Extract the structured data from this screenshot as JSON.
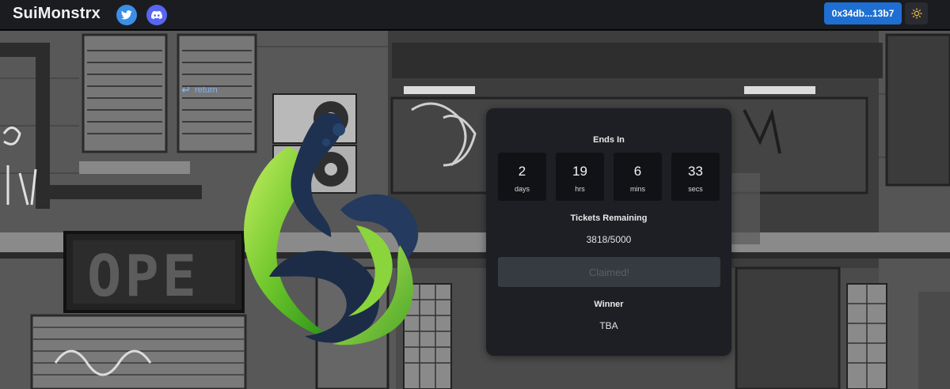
{
  "header": {
    "brand": "SuiMonstrx",
    "wallet_label": "0x34db...13b7",
    "social": [
      "twitter-icon",
      "discord-icon"
    ],
    "theme_icon": "sun-icon"
  },
  "nav": {
    "return_label": "return",
    "return_icon": "return-arrow-icon"
  },
  "background": {
    "scene": "grayscale cartoon city alley",
    "sign_text": "OPE"
  },
  "raffle": {
    "ends_label": "Ends In",
    "countdown": [
      {
        "value": "2",
        "unit": "days"
      },
      {
        "value": "19",
        "unit": "hrs"
      },
      {
        "value": "6",
        "unit": "mins"
      },
      {
        "value": "33",
        "unit": "secs"
      }
    ],
    "tickets_label": "Tickets Remaining",
    "tickets_value": "3818/5000",
    "claim_label": "Claimed!",
    "winner_label": "Winner",
    "winner_value": "TBA"
  },
  "colors": {
    "wallet_button": "#1e6fd1",
    "card_bg": "#1e1f24",
    "logo_green": "#59b927",
    "logo_navy": "#1e2f4a"
  }
}
